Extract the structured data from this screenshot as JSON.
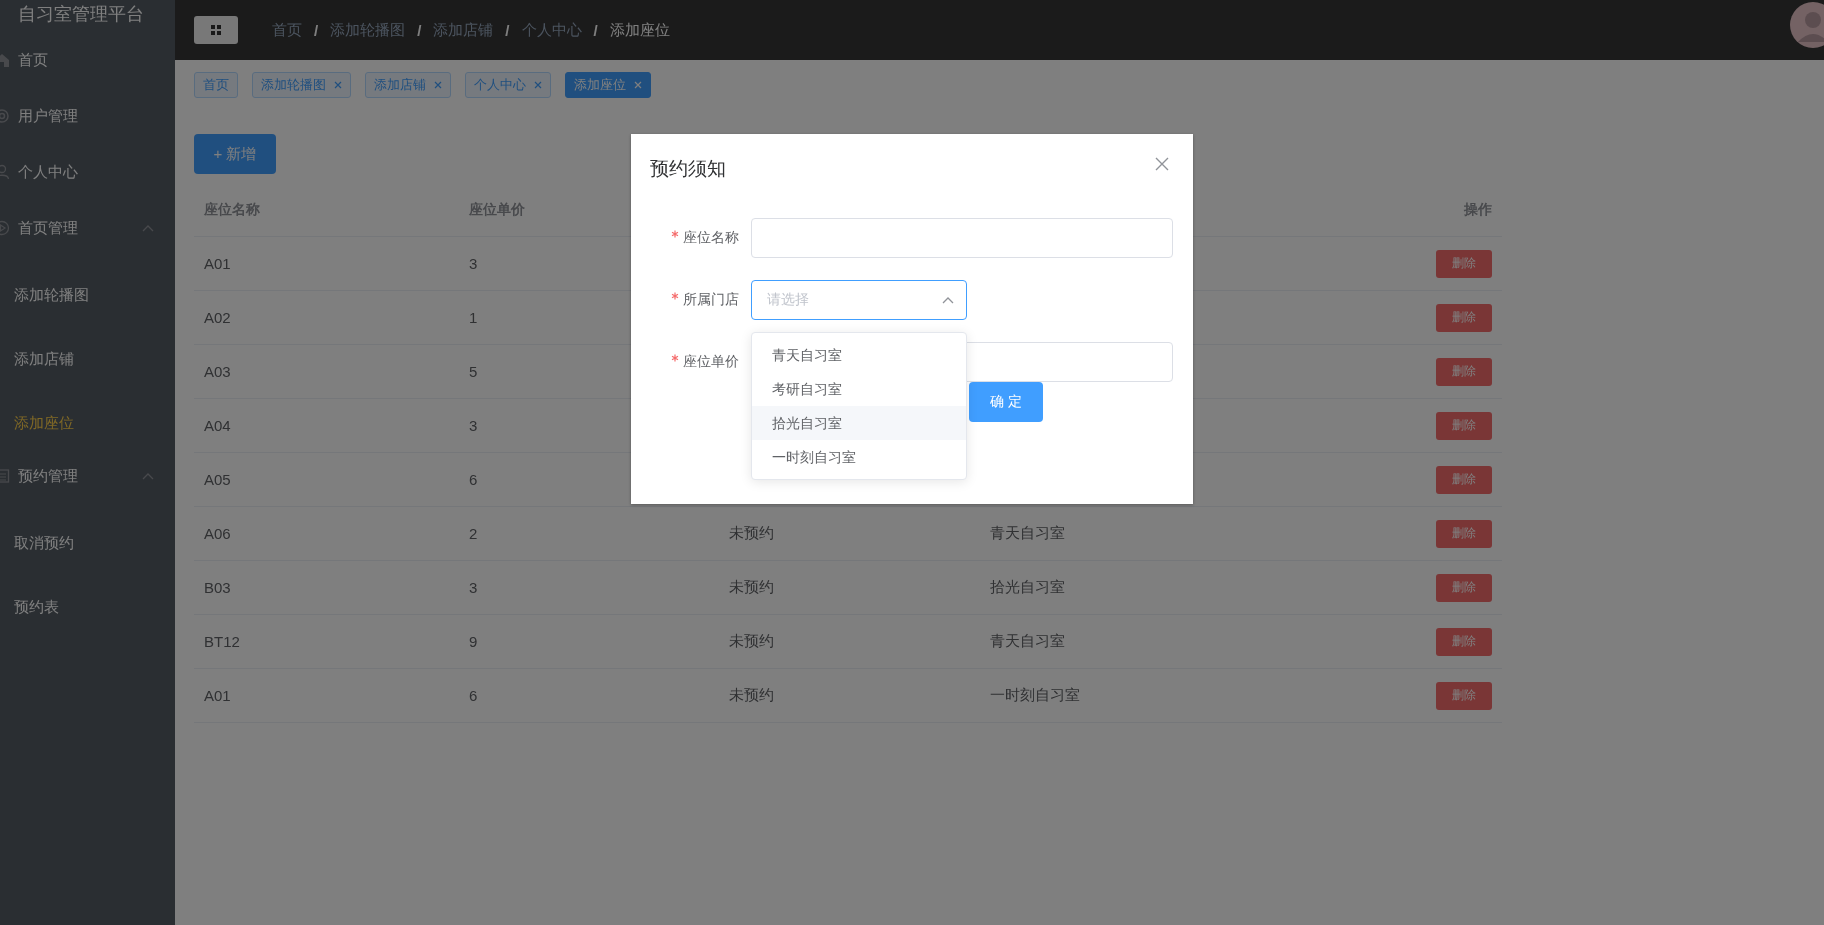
{
  "sidebar": {
    "title": "自习室管理平台",
    "items": [
      {
        "label": "首页",
        "selected": false
      },
      {
        "label": "用户管理",
        "selected": false
      },
      {
        "label": "个人中心",
        "selected": false
      },
      {
        "label": "首页管理",
        "selected": false,
        "expanded": true,
        "children": [
          {
            "label": "添加轮播图",
            "selected": false
          },
          {
            "label": "添加店铺",
            "selected": false
          },
          {
            "label": "添加座位",
            "selected": true
          }
        ]
      },
      {
        "label": "预约管理",
        "selected": false,
        "expanded": true,
        "children": [
          {
            "label": "取消预约",
            "selected": false
          },
          {
            "label": "预约表",
            "selected": false
          }
        ]
      }
    ]
  },
  "breadcrumb": [
    "首页",
    "添加轮播图",
    "添加店铺",
    "个人中心",
    "添加座位"
  ],
  "breadcrumb_separator": "/",
  "tags": [
    {
      "label": "首页",
      "selected": false,
      "closable": false
    },
    {
      "label": "添加轮播图",
      "selected": false,
      "closable": true
    },
    {
      "label": "添加店铺",
      "selected": false,
      "closable": true
    },
    {
      "label": "个人中心",
      "selected": false,
      "closable": true
    },
    {
      "label": "添加座位",
      "selected": true,
      "closable": true
    }
  ],
  "add_button": "+ 新增",
  "table": {
    "columns": [
      {
        "label": "座位名称"
      },
      {
        "label": "座位单价"
      },
      {},
      {},
      {
        "label": "操作"
      }
    ],
    "rows": [
      {
        "column_1": "A01",
        "column_2": "3",
        "action": "删除"
      },
      {
        "column_1": "A02",
        "column_2": "1",
        "action": "删除"
      },
      {
        "column_1": "A03",
        "column_2": "5",
        "action": "删除"
      },
      {
        "column_1": "A04",
        "column_2": "3",
        "action": "删除"
      },
      {
        "column_1": "A05",
        "column_2": "6",
        "action": "删除"
      },
      {
        "column_1": "A06",
        "column_2": "2",
        "column_3": "未预约",
        "column_4": "青天自习室",
        "action": "删除"
      },
      {
        "column_1": "B03",
        "column_2": "3",
        "column_3": "未预约",
        "column_4": "拾光自习室",
        "action": "删除"
      },
      {
        "column_1": "BT12",
        "column_2": "9",
        "column_3": "未预约",
        "column_4": "青天自习室",
        "action": "删除"
      },
      {
        "column_1": "A01",
        "column_2": "6",
        "column_3": "未预约",
        "column_4": "一时刻自习室",
        "action": "删除"
      }
    ]
  },
  "dialog": {
    "title": "预约须知",
    "fields": [
      {
        "kind": "input",
        "label": "座位名称",
        "required": true
      },
      {
        "kind": "select",
        "label": "所属门店",
        "required": true,
        "placeholder": "请选择",
        "expanded": true,
        "options": [
          {
            "label": "青天自习室",
            "hovered": false
          },
          {
            "label": "考研自习室",
            "hovered": false
          },
          {
            "label": "拾光自习室",
            "hovered": true
          },
          {
            "label": "一时刻自习室",
            "hovered": false
          }
        ]
      },
      {
        "kind": "input",
        "label": "座位单价",
        "required": true
      }
    ],
    "confirm_button": "确 定"
  }
}
